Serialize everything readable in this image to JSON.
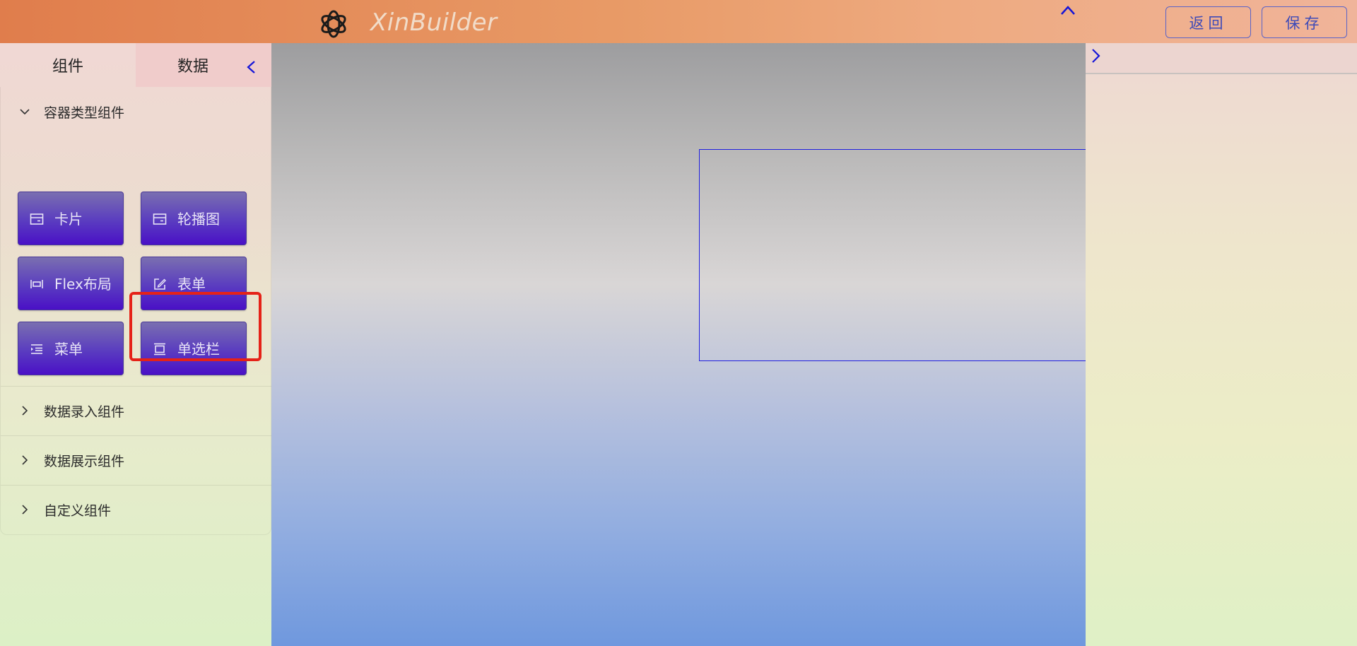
{
  "header": {
    "app_title": "XinBuilder",
    "back_label": "返回",
    "save_label": "保存",
    "logo_icon": "openai-knot-logo-icon",
    "collapse_icon": "chevron-up-icon"
  },
  "left_panel": {
    "tabs": [
      {
        "label": "组件",
        "active": true
      },
      {
        "label": "数据",
        "active": false
      }
    ],
    "collapse_icon": "chevron-left-icon",
    "sections": [
      {
        "title": "容器类型组件",
        "expanded": true,
        "items": [
          {
            "label": "卡片",
            "icon": "card-icon"
          },
          {
            "label": "轮播图",
            "icon": "carousel-icon"
          },
          {
            "label": "Flex布局",
            "icon": "flex-layout-icon"
          },
          {
            "label": "表单",
            "icon": "edit-form-icon",
            "highlighted": true
          },
          {
            "label": "菜单",
            "icon": "menu-indent-icon"
          },
          {
            "label": "单选栏",
            "icon": "radio-bar-icon"
          }
        ]
      },
      {
        "title": "数据录入组件",
        "expanded": false
      },
      {
        "title": "数据展示组件",
        "expanded": false
      },
      {
        "title": "自定义组件",
        "expanded": false
      }
    ]
  },
  "right_panel": {
    "expand_icon": "chevron-right-icon"
  },
  "colors": {
    "accent": "#3d4ab8",
    "component_button": "#4a10c6",
    "highlight": "#e52218",
    "selection": "#2020e0"
  }
}
